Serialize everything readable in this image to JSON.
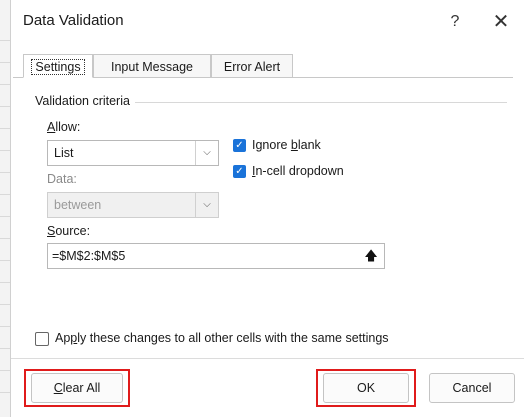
{
  "dialog": {
    "title": "Data Validation",
    "help_glyph": "?",
    "close_glyph": "✕"
  },
  "tabs": [
    {
      "label": "Settings",
      "selected": true
    },
    {
      "label": "Input Message",
      "selected": false
    },
    {
      "label": "Error Alert",
      "selected": false
    }
  ],
  "settings": {
    "section_title": "Validation criteria",
    "allow": {
      "label_accel": "A",
      "label_rest": "llow:",
      "value": "List"
    },
    "data": {
      "label": "Data:",
      "value": "between",
      "disabled": true
    },
    "ignore_blank": {
      "label_pre": "Ignore ",
      "label_accel": "b",
      "label_post": "lank",
      "checked": true
    },
    "in_cell_dropdown": {
      "label_accel": "I",
      "label_rest": "n-cell dropdown",
      "checked": true
    },
    "source": {
      "label_accel": "S",
      "label_rest": "ource:",
      "value": "=$M$2:$M$5",
      "button_glyph": "🡅"
    },
    "apply_all": {
      "label_pre": "Ap",
      "label_accel": "p",
      "label_post": "ly these changes to all other cells with the same settings",
      "checked": false
    }
  },
  "buttons": {
    "clear_all": {
      "label_accel": "C",
      "label_rest": "lear All"
    },
    "ok": "OK",
    "cancel": "Cancel"
  },
  "highlight_color": "#e01b1b",
  "check_color": "#1a73d9"
}
